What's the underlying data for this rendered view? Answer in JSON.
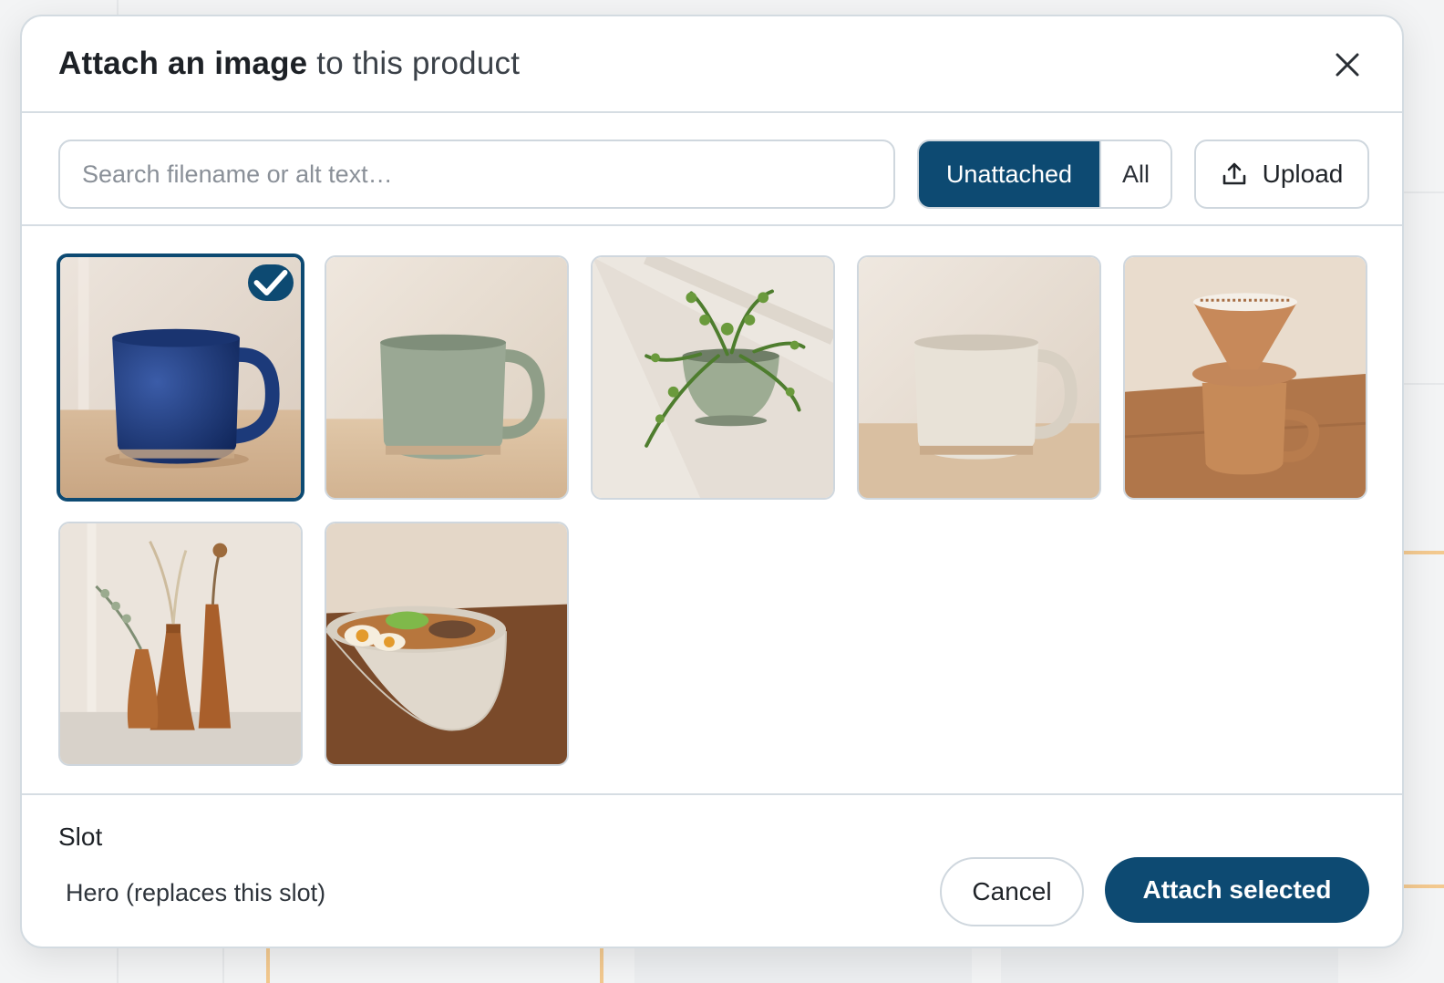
{
  "dialog": {
    "title_bold": "Attach an image",
    "title_rest": "to this product",
    "close_icon": "close-icon"
  },
  "toolbar": {
    "search_placeholder": "Search filename or alt text…",
    "search_value": "",
    "filter_options": [
      "Unattached",
      "All"
    ],
    "filter_selected": "Unattached",
    "upload_label": "Upload",
    "upload_icon": "upload-icon"
  },
  "images": [
    {
      "subject": "cobalt blue ceramic mug",
      "selected": true
    },
    {
      "subject": "sage green ceramic mug",
      "selected": false
    },
    {
      "subject": "wall planter with fern",
      "selected": false
    },
    {
      "subject": "cream speckled ceramic mug",
      "selected": false
    },
    {
      "subject": "pour-over dripper on mug",
      "selected": false
    },
    {
      "subject": "three wooden bud vases",
      "selected": false
    },
    {
      "subject": "ramen in ceramic bowl",
      "selected": false
    }
  ],
  "footer": {
    "slot_label": "Slot",
    "slot_value": "Hero (replaces this slot)",
    "cancel_label": "Cancel",
    "attach_label": "Attach selected"
  },
  "colors": {
    "accent": "#0d4a72",
    "border": "#cfd7de"
  }
}
